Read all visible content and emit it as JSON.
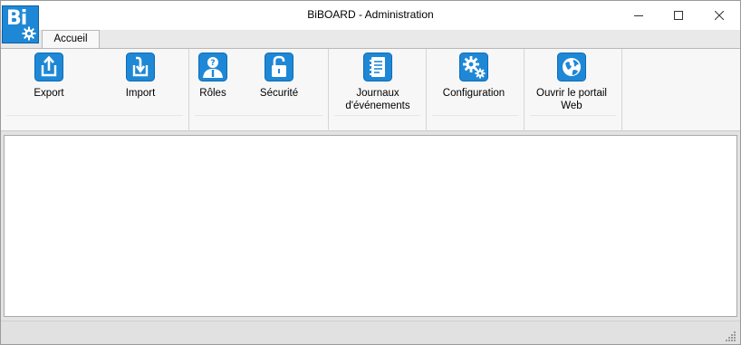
{
  "window": {
    "title": "BiBOARD - Administration",
    "logo_text": "Bi",
    "logo_icon": "gear-icon",
    "controls": {
      "minimize": "minimize-icon",
      "maximize": "maximize-icon",
      "close": "close-icon"
    }
  },
  "tabs": [
    {
      "label": "Accueil",
      "selected": true
    }
  ],
  "ribbon": {
    "accent_color": "#1e88d6",
    "groups": [
      {
        "buttons": [
          {
            "label": "Export",
            "icon": "export-icon"
          },
          {
            "label": "Import",
            "icon": "import-icon"
          }
        ]
      },
      {
        "buttons": [
          {
            "label": "Rôles",
            "icon": "user-question-icon"
          },
          {
            "label": "Sécurité",
            "icon": "lock-icon"
          }
        ]
      },
      {
        "buttons": [
          {
            "label": "Journaux d'événements",
            "icon": "notebook-icon"
          }
        ]
      },
      {
        "buttons": [
          {
            "label": "Configuration",
            "icon": "gears-icon"
          }
        ]
      },
      {
        "buttons": [
          {
            "label": "Ouvrir le portail Web",
            "icon": "globe-icon"
          }
        ]
      }
    ]
  },
  "statusbar": {
    "grip_icon": "resize-grip-icon"
  }
}
